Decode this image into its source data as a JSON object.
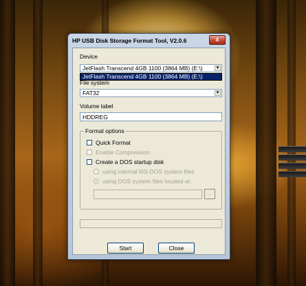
{
  "window": {
    "title": "HP USB Disk Storage Format Tool, V2.0.6",
    "close_glyph": "x"
  },
  "device": {
    "label": "Device",
    "selected": "JetFlash Transcend 4GB 1100 (3864 MB) (E:\\)",
    "dropdown_items": [
      "JetFlash Transcend 4GB 1100 (3864 MB) (E:\\)"
    ]
  },
  "file_system": {
    "label_partial": "File system",
    "selected": "FAT32"
  },
  "volume": {
    "label": "Volume label",
    "value": "HDDREG"
  },
  "format_options": {
    "title": "Format options",
    "quick_format": {
      "label": "Quick Format",
      "checked": false,
      "enabled": true
    },
    "enable_compression": {
      "label": "Enable Compression",
      "checked": false,
      "enabled": false
    },
    "dos_startup": {
      "label": "Create a DOS startup disk",
      "checked": false,
      "enabled": true
    },
    "radio_internal": {
      "label": "using internal MS-DOS system files",
      "checked": false,
      "enabled": false
    },
    "radio_located": {
      "label": "using DOS system files located at:",
      "checked": true,
      "enabled": false
    },
    "path_value": "",
    "browse_label": "..."
  },
  "progress": {
    "value": 0
  },
  "buttons": {
    "start": "Start",
    "close": "Close"
  },
  "icons": {
    "dropdown_arrow": "chevron-down-icon",
    "close": "close-icon"
  }
}
